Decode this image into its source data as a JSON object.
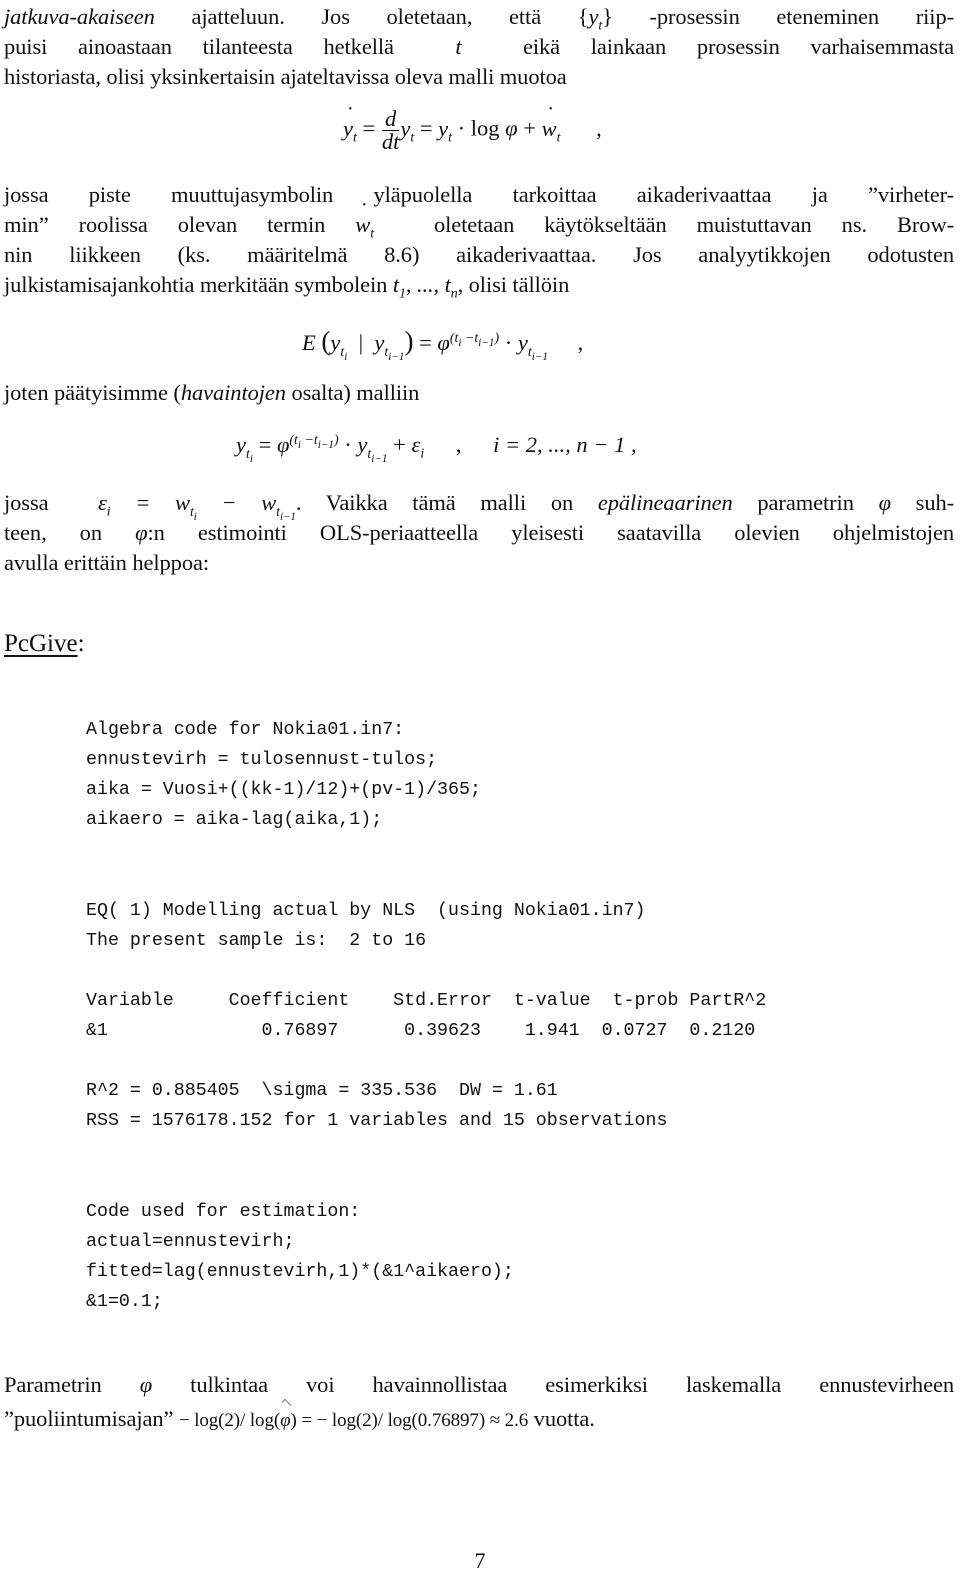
{
  "page": {
    "number": "7",
    "para1": {
      "l1_a": "jatkuva-akaiseen",
      "l1_b": " ajatteluun. Jos oletetaan, että  {",
      "l1_c": "} -prosessin eteneminen riip-",
      "l2_a": "puisi ainoastaan tilanteesta hetkellä ",
      "l2_b": " eikä lainkaan prosessin varhaisemmasta",
      "l3": "historiasta, olisi yksinkertaisin ajateltavissa oleva malli muotoa"
    },
    "eq1": {
      "lhs": "y",
      "sub": "t",
      "d": "d",
      "dt": "dt",
      "log": "log",
      "phi": "φ",
      "w": "w",
      "comma": ","
    },
    "para2": {
      "l1": "jossa piste muuttujasymbolin yläpuolella tarkoittaa aikaderivaattaa ja ”virheter-",
      "l2_a": "min” roolissa olevan termin ",
      "l2_b": " oletetaan käytökseltään muistuttavan ns. Brow-",
      "l3": "nin liikkeen (ks. määritelmä 8.6) aikaderivaattaa. Jos analyytikkojen odotusten",
      "l4_a": "julkistamisajankohtia merkitään symbolein ",
      "l4_b": ", olisi tällöin"
    },
    "eq2": {
      "E": "E",
      "comma": ","
    },
    "para3": {
      "a": "joten päätyisimme (",
      "b": "havaintojen",
      "c": " osalta) malliin"
    },
    "eq3": {
      "range": "i = 2, ..., n − 1 ,"
    },
    "para4": {
      "l1_a": "jossa ",
      "l1_b": ". Vaikka tämä malli on ",
      "l1_c": "epälineaarinen",
      "l1_d": " parametrin ",
      "l1_e": " suh-",
      "l2_a": "teen, on ",
      "l2_b": ":n estimointi OLS-periaatteella yleisesti saatavilla olevien ohjelmistojen",
      "l3": "avulla erittäin helppoa:"
    },
    "heading": "PcGive",
    "heading_colon": ":",
    "code_block_1": [
      "Algebra code for Nokia01.in7:",
      "ennustevirh = tulosennust-tulos;",
      "aika = Vuosi+((kk-1)/12)+(pv-1)/365;",
      "aikaero = aika-lag(aika,1);"
    ],
    "output_block": {
      "line1": "EQ( 1) Modelling actual by NLS  (using Nokia01.in7)",
      "line2": "The present sample is:  2 to 16",
      "table_header": "Variable     Coefficient    Std.Error  t-value  t-prob PartR^2",
      "table_row": "&1              0.76897      0.39623    1.941  0.0727  0.2120",
      "stats1": "R^2 = 0.885405  \\sigma = 335.536  DW = 1.61",
      "stats2": "RSS = 1576178.152 for 1 variables and 15 observations"
    },
    "code_block_2": [
      "Code used for estimation:",
      "actual=ennustevirh;",
      "fitted=lag(ennustevirh,1)*(&1^aikaero);",
      "&1=0.1;"
    ],
    "para5": {
      "l1_a": "Parametrin ",
      "l1_b": " tulkintaa voi havainnollistaa esimerkiksi laskemalla ennustevirheen",
      "l2_a": "”puoliintumisajan”  ",
      "l2_b": "− log(2)/ log(",
      "l2_c": ") = − log(2)/ log(0.76897) ≈ 2.6",
      "l2_d": "  vuotta."
    }
  }
}
